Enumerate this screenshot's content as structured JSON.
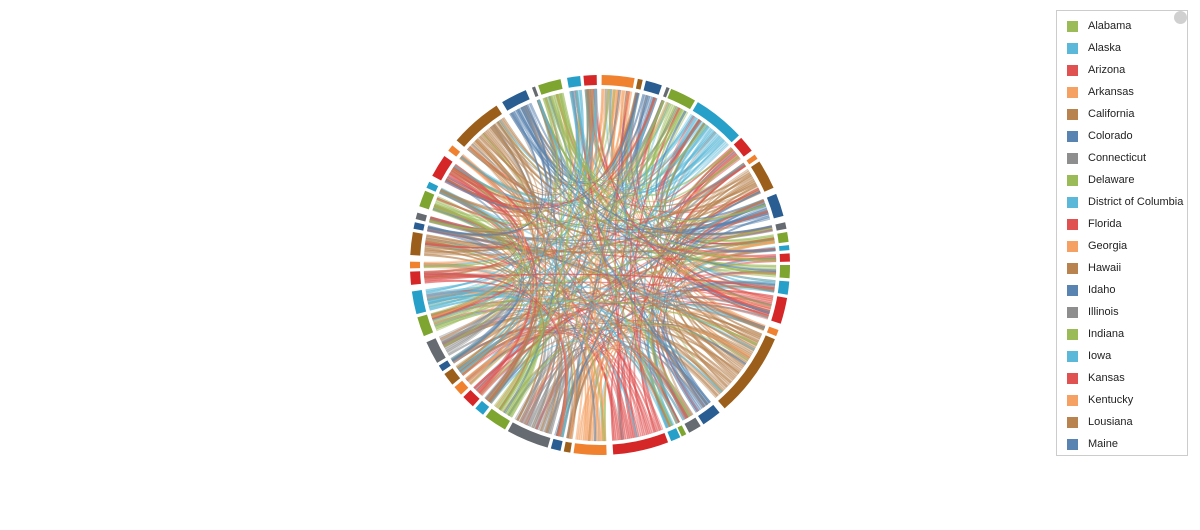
{
  "legend": {
    "items": [
      {
        "label": "Alabama",
        "color": "#9bbb59"
      },
      {
        "label": "Alaska",
        "color": "#5bb8d8"
      },
      {
        "label": "Arizona",
        "color": "#e05252"
      },
      {
        "label": "Arkansas",
        "color": "#f4a163"
      },
      {
        "label": "California",
        "color": "#b8834f"
      },
      {
        "label": "Colorado",
        "color": "#5983b0"
      },
      {
        "label": "Connecticut",
        "color": "#8e8e8e"
      },
      {
        "label": "Delaware",
        "color": "#9bbb59"
      },
      {
        "label": "District of Columbia",
        "color": "#5bb8d8"
      },
      {
        "label": "Florida",
        "color": "#e05252"
      },
      {
        "label": "Georgia",
        "color": "#f4a163"
      },
      {
        "label": "Hawaii",
        "color": "#b8834f"
      },
      {
        "label": "Idaho",
        "color": "#5983b0"
      },
      {
        "label": "Illinois",
        "color": "#8e8e8e"
      },
      {
        "label": "Indiana",
        "color": "#9bbb59"
      },
      {
        "label": "Iowa",
        "color": "#5bb8d8"
      },
      {
        "label": "Kansas",
        "color": "#e05252"
      },
      {
        "label": "Kentucky",
        "color": "#f4a163"
      },
      {
        "label": "Lousiana",
        "color": "#b8834f"
      },
      {
        "label": "Maine",
        "color": "#5983b0"
      }
    ]
  },
  "palette": {
    "ring": {
      "red": "#d62728",
      "orange": "#f0812f",
      "brown": "#9c5f1b",
      "blue": "#2a5d91",
      "gray": "#656b70",
      "green": "#7da52f",
      "cyan": "#26a0c9"
    },
    "chord": {
      "red": "#e05252",
      "orange": "#f4a163",
      "brown": "#b8834f",
      "blue": "#5983b0",
      "gray": "#8e8e8e",
      "green": "#9bbb59",
      "cyan": "#5bb8d8"
    }
  }
}
